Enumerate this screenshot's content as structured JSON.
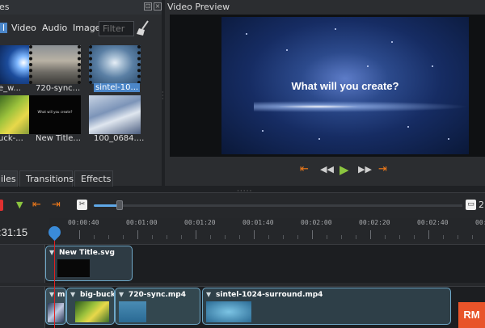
{
  "project_files": {
    "title": "es",
    "filter_tabs": [
      "l",
      "Video",
      "Audio",
      "Image"
    ],
    "filter_placeholder": "Filter",
    "items": [
      {
        "label": "e_w..."
      },
      {
        "label": "720-sync..."
      },
      {
        "label": "sintel-10..."
      },
      {
        "label": "uck-..."
      },
      {
        "label": "New Title..."
      },
      {
        "label": "100_0684...."
      }
    ],
    "thumb_title_text": "What will you create?",
    "bottom_tabs": [
      "iles",
      "Transitions",
      "Effects"
    ]
  },
  "preview": {
    "title": "Video Preview",
    "caption": "What will you create?"
  },
  "timeline": {
    "timecode": ":31:15",
    "ruler_labels": [
      "00:00:40",
      "00:01:00",
      "00:01:20",
      "00:01:40",
      "00:02:00",
      "00:02:20",
      "00:02:40",
      "00:0"
    ],
    "zoom_value": "2",
    "clips": [
      {
        "title": "New Title.svg"
      },
      {
        "title": "m"
      },
      {
        "title": "big-buck-"
      },
      {
        "title": "720-sync.mp4"
      },
      {
        "title": "sintel-1024-surround.mp4"
      }
    ]
  },
  "watermark": "RM",
  "colors": {
    "accent": "#4b86c8",
    "playback_orange": "#f07a1a",
    "play_green": "#8bc53f",
    "playhead": "#e02020",
    "clip_border": "#6fa8c8",
    "video_blue": "#2c4a8c",
    "logo_orange": "#e8542a"
  },
  "icons": [
    "close-icon",
    "float-icon",
    "broom-icon",
    "jump-start-icon",
    "rewind-icon",
    "play-icon",
    "fast-forward-icon",
    "jump-end-icon",
    "add-track-icon",
    "filter-marker-icon",
    "snap-icon",
    "razor-icon",
    "zoom-icon",
    "playhead-icon"
  ]
}
